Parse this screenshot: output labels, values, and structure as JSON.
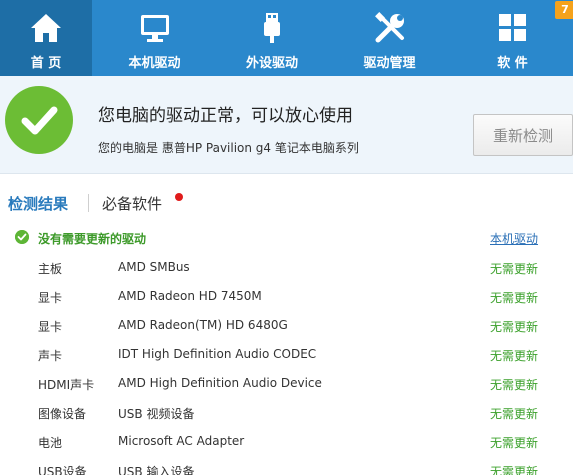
{
  "nav": {
    "items": [
      {
        "label": "首 页",
        "icon": "home-icon"
      },
      {
        "label": "本机驱动",
        "icon": "monitor-icon"
      },
      {
        "label": "外设驱动",
        "icon": "usb-icon"
      },
      {
        "label": "驱动管理",
        "icon": "tools-icon"
      },
      {
        "label": "软 件",
        "icon": "apps-grid-icon",
        "badge": "7"
      }
    ],
    "colors": {
      "bar": "#2a88cc",
      "active": "#1e6ea6",
      "badge": "#f5a21b"
    }
  },
  "status": {
    "title": "您电脑的驱动正常，可以放心使用",
    "subtitle": "您的电脑是 惠普HP Pavilion g4 笔记本电脑系列",
    "rescan_label": "重新检测",
    "icon": "check-icon"
  },
  "tabs": {
    "results": "检测结果",
    "software": "必备软件"
  },
  "summary": {
    "text": "没有需要更新的驱动",
    "link": "本机驱动"
  },
  "devices": [
    {
      "category": "主板",
      "name": "AMD SMBus",
      "status": "无需更新"
    },
    {
      "category": "显卡",
      "name": "AMD Radeon HD 7450M",
      "status": "无需更新"
    },
    {
      "category": "显卡",
      "name": "AMD Radeon(TM) HD 6480G",
      "status": "无需更新"
    },
    {
      "category": "声卡",
      "name": "IDT High Definition Audio CODEC",
      "status": "无需更新"
    },
    {
      "category": "HDMI声卡",
      "name": "AMD High Definition Audio Device",
      "status": "无需更新"
    },
    {
      "category": "图像设备",
      "name": "USB 视频设备",
      "status": "无需更新"
    },
    {
      "category": "电池",
      "name": "Microsoft AC Adapter",
      "status": "无需更新"
    },
    {
      "category": "USB设备",
      "name": "USB 输入设备",
      "status": "无需更新"
    }
  ]
}
